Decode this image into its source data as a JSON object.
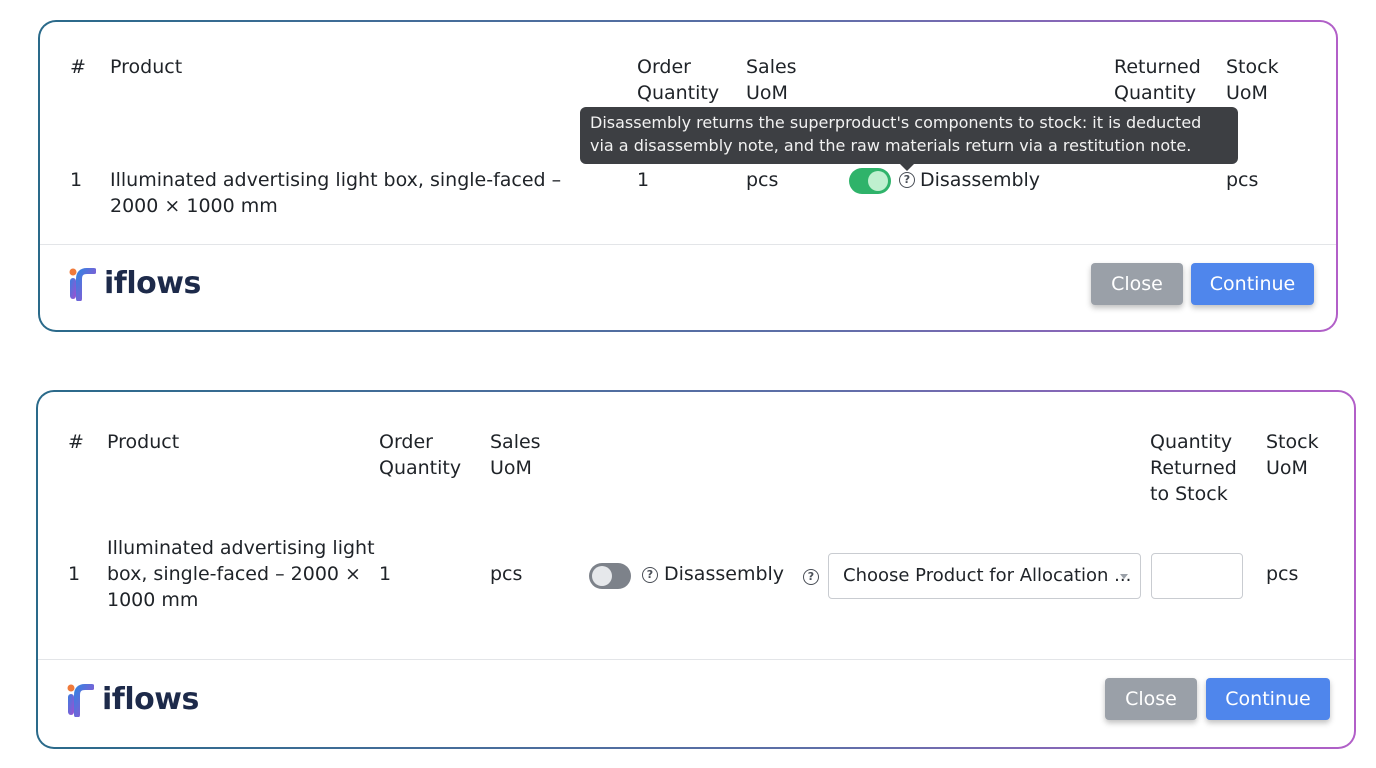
{
  "dialog1": {
    "headers": {
      "num": "#",
      "product": "Product",
      "order_quantity": "Order Quantity",
      "sales_uom": "Sales UoM",
      "returned_quantity": "Returned Quantity",
      "stock_uom": "Stock UoM"
    },
    "row": {
      "num": "1",
      "product": "Illuminated advertising light box, single-faced – 2000 × 1000 mm",
      "order_quantity": "1",
      "sales_uom": "pcs",
      "disassembly_toggle": "on",
      "disassembly_label": "Disassembly",
      "stock_uom": "pcs"
    },
    "tooltip": "Disassembly returns the superproduct's components to stock: it is deducted via a disassembly note, and the raw materials return via a restitution note.",
    "close_label": "Close",
    "continue_label": "Continue"
  },
  "dialog2": {
    "headers": {
      "num": "#",
      "product": "Product",
      "order_quantity": "Order Quantity",
      "sales_uom": "Sales UoM",
      "quantity_returned": "Quantity Returned to Stock",
      "stock_uom": "Stock UoM"
    },
    "row": {
      "num": "1",
      "product": "Illuminated advertising light box, single-faced – 2000 × 1000 mm",
      "order_quantity": "1",
      "sales_uom": "pcs",
      "disassembly_toggle": "off",
      "disassembly_label": "Disassembly",
      "allocation_placeholder": "Choose Product for Allocation ...",
      "quantity_value": "",
      "stock_uom": "pcs"
    },
    "close_label": "Close",
    "continue_label": "Continue"
  },
  "brand": {
    "name": "iflows",
    "icon": "iflows-logo-icon"
  },
  "colors": {
    "toggle_on": "#2fb36a",
    "toggle_off": "#7d828a",
    "primary_button": "#4f86ec",
    "secondary_button": "#9aa0a8",
    "tooltip_bg": "#3d3f43"
  },
  "icons": {
    "help": "help-circle-icon",
    "caret": "chevron-down-icon"
  }
}
